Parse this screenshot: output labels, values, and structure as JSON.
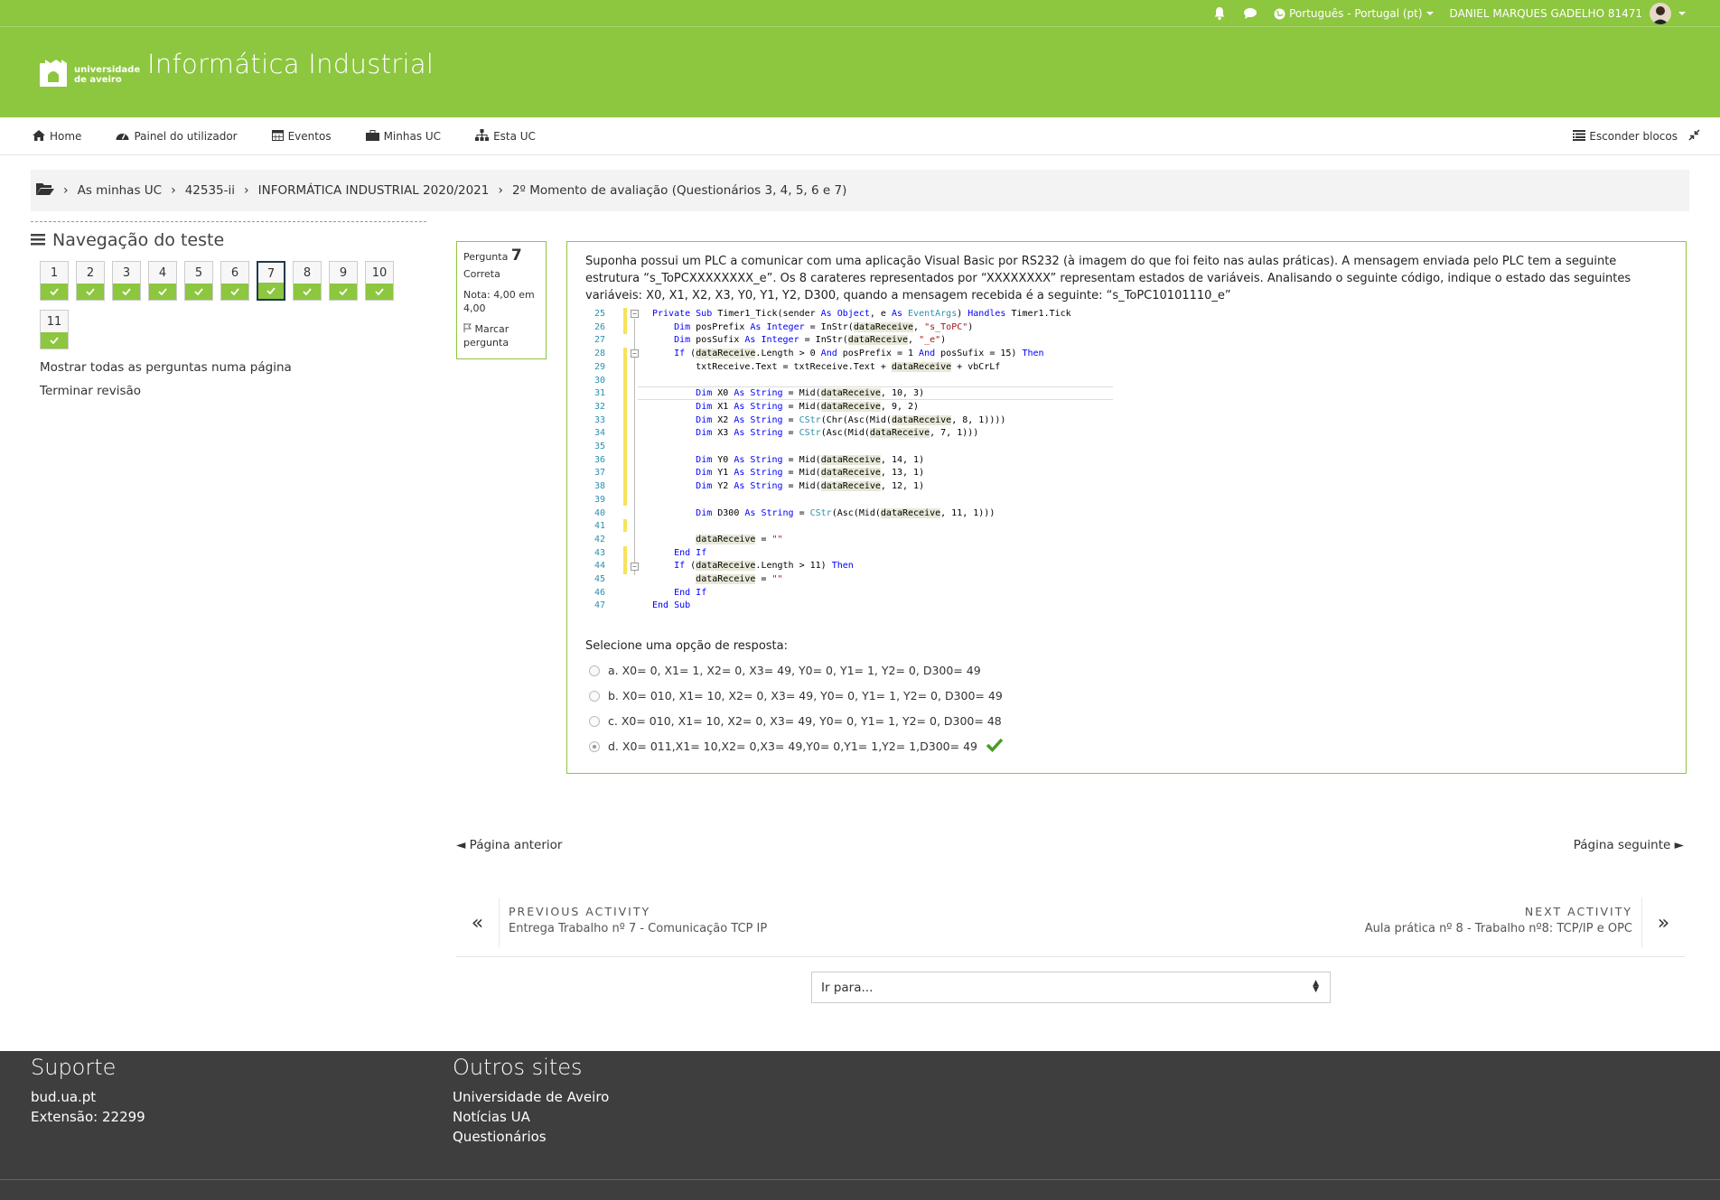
{
  "topbar": {
    "language": "Português - Portugal (pt)",
    "user_name": "DANIEL MARQUES GADELHO 81471",
    "bell_icon": "bell-icon",
    "messages_icon": "chat-icon"
  },
  "header": {
    "logo_line1": "universidade",
    "logo_line2": "de aveiro",
    "site_title": "Informática Industrial"
  },
  "navbar": {
    "items": [
      {
        "label": "Home",
        "icon": "home-icon"
      },
      {
        "label": "Painel do utilizador",
        "icon": "dashboard-icon"
      },
      {
        "label": "Eventos",
        "icon": "calendar-icon"
      },
      {
        "label": "Minhas UC",
        "icon": "briefcase-icon"
      },
      {
        "label": "Esta UC",
        "icon": "sitemap-icon"
      }
    ],
    "hide_blocks": "Esconder blocos"
  },
  "breadcrumb": {
    "items": [
      "As minhas UC",
      "42535-ii",
      "INFORMÁTICA INDUSTRIAL 2020/2021",
      "2º Momento de avaliação (Questionários 3, 4, 5, 6 e 7)"
    ]
  },
  "quiz_nav": {
    "title": "Navegação do teste",
    "questions": [
      "1",
      "2",
      "3",
      "4",
      "5",
      "6",
      "7",
      "8",
      "9",
      "10",
      "11"
    ],
    "current": "7",
    "show_all": "Mostrar todas as perguntas numa página",
    "finish": "Terminar revisão"
  },
  "question_info": {
    "label": "Pergunta",
    "number": "7",
    "state": "Correta",
    "grade_line1": "Nota: 4,00 em",
    "grade_line2": "4,00",
    "flag_line1": "Marcar",
    "flag_line2": "pergunta"
  },
  "question": {
    "text": "Suponha possui um PLC a comunicar com uma aplicação Visual Basic por RS232 (à imagem do que foi feito nas aulas práticas). A mensagem enviada pelo PLC tem a seguinte estrutura “s_ToPCXXXXXXXX_e”. Os 8 carateres representados por “XXXXXXXX” representam estados de variáveis. Analisando o seguinte código, indique o estado das seguintes variáveis: X0, X1, X2, X3, Y0, Y1, Y2, D300, quando a mensagem recebida é a seguinte: “s_ToPC10101110_e”",
    "line_numbers": [
      "25",
      "26",
      "27",
      "28",
      "29",
      "30",
      "31",
      "32",
      "33",
      "34",
      "35",
      "36",
      "37",
      "38",
      "39",
      "40",
      "41",
      "42",
      "43",
      "44",
      "45",
      "46",
      "47"
    ],
    "prompt": "Selecione uma opção de resposta:",
    "answers": [
      "a. X0= 0, X1= 1, X2= 0, X3= 49, Y0= 0, Y1= 1, Y2= 0, D300= 49",
      "b. X0= 010, X1= 10, X2= 0, X3= 49, Y0= 0, Y1= 1, Y2= 0, D300= 49",
      "c. X0= 010, X1= 10, X2= 0, X3= 49, Y0= 0, Y1= 1, Y2= 0, D300= 48",
      "d. X0= 011,X1= 10,X2= 0,X3= 49,Y0= 0,Y1= 1,Y2= 1,D300= 49"
    ],
    "selected": "d",
    "correct_icon": "checkmark-icon"
  },
  "page_nav": {
    "prev": "◄ Página anterior",
    "next": "Página seguinte ►"
  },
  "activity_nav": {
    "prev_label": "PREVIOUS ACTIVITY",
    "prev_title": "Entrega Trabalho nº 7 - Comunicação TCP IP",
    "next_label": "NEXT ACTIVITY",
    "next_title": "Aula prática nº 8 - Trabalho nº8: TCP/IP e OPC"
  },
  "jump_to": {
    "placeholder": "Ir para..."
  },
  "footer": {
    "support_title": "Suporte",
    "support_items": [
      "bud.ua.pt",
      "Extensão: 22299"
    ],
    "sites_title": "Outros sites",
    "sites_items": [
      "Universidade de Aveiro",
      "Notícias UA",
      "Questionários"
    ]
  },
  "colors": {
    "brand_green": "#8dc63f",
    "footer_bg": "#3e3e3e",
    "current_question_border": "#1f3b4d",
    "correct_check": "#4c9a2a"
  }
}
